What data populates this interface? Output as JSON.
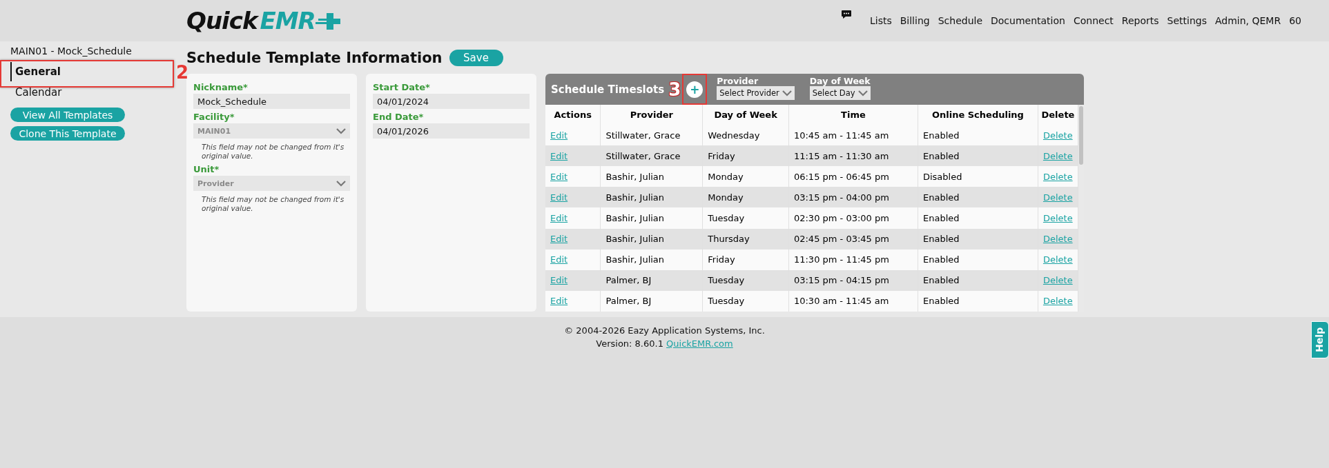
{
  "header": {
    "logo": {
      "part_1": "Quick",
      "part_2": "EMR"
    },
    "nav": [
      "Lists",
      "Billing",
      "Schedule",
      "Documentation",
      "Connect",
      "Reports",
      "Settings",
      "Admin, QEMR",
      "60"
    ]
  },
  "sidebar": {
    "title": "MAIN01 - Mock_Schedule",
    "items": [
      {
        "label": "General",
        "selected": true
      },
      {
        "label": "Calendar",
        "selected": false
      }
    ],
    "buttons": [
      "View All Templates",
      "Clone This Template"
    ]
  },
  "page": {
    "title": "Schedule Template Information",
    "save_button": "Save"
  },
  "form": {
    "fields": [
      {
        "label": "Nickname*",
        "value": "Mock_Schedule",
        "disabled": false
      },
      {
        "label": "Facility*",
        "value": "MAIN01",
        "disabled": true,
        "note": "This field may not be changed from it's original value."
      },
      {
        "label": "Unit*",
        "value": "Provider",
        "disabled": true,
        "note": "This field may not be changed from it's original value."
      }
    ],
    "dates": [
      {
        "label": "Start Date*",
        "value": "04/01/2024"
      },
      {
        "label": "End Date*",
        "value": "04/01/2026"
      }
    ]
  },
  "timeslots": {
    "title": "Schedule Timeslots",
    "add_button": "+",
    "filters": [
      {
        "label": "Provider",
        "value": "Select Provider"
      },
      {
        "label": "Day of Week",
        "value": "Select Day"
      }
    ],
    "columns": [
      "Actions",
      "Provider",
      "Day of Week",
      "Time",
      "Online Scheduling",
      "Delete"
    ],
    "rows": [
      {
        "action": "Edit",
        "provider": "Stillwater, Grace",
        "day": "Wednesday",
        "time": "10:45 am - 11:45 am",
        "online": "Enabled",
        "delete": "Delete"
      },
      {
        "action": "Edit",
        "provider": "Stillwater, Grace",
        "day": "Friday",
        "time": "11:15 am - 11:30 am",
        "online": "Enabled",
        "delete": "Delete"
      },
      {
        "action": "Edit",
        "provider": "Bashir, Julian",
        "day": "Monday",
        "time": "06:15 pm - 06:45 pm",
        "online": "Disabled",
        "delete": "Delete"
      },
      {
        "action": "Edit",
        "provider": "Bashir, Julian",
        "day": "Monday",
        "time": "03:15 pm - 04:00 pm",
        "online": "Enabled",
        "delete": "Delete"
      },
      {
        "action": "Edit",
        "provider": "Bashir, Julian",
        "day": "Tuesday",
        "time": "02:30 pm - 03:00 pm",
        "online": "Enabled",
        "delete": "Delete"
      },
      {
        "action": "Edit",
        "provider": "Bashir, Julian",
        "day": "Thursday",
        "time": "02:45 pm - 03:45 pm",
        "online": "Enabled",
        "delete": "Delete"
      },
      {
        "action": "Edit",
        "provider": "Bashir, Julian",
        "day": "Friday",
        "time": "11:30 pm - 11:45 pm",
        "online": "Enabled",
        "delete": "Delete"
      },
      {
        "action": "Edit",
        "provider": "Palmer, BJ",
        "day": "Tuesday",
        "time": "03:15 pm - 04:15 pm",
        "online": "Enabled",
        "delete": "Delete"
      },
      {
        "action": "Edit",
        "provider": "Palmer, BJ",
        "day": "Tuesday",
        "time": "10:30 am - 11:45 am",
        "online": "Enabled",
        "delete": "Delete"
      }
    ]
  },
  "footer": {
    "copyright": "© 2004-2026 Eazy Application Systems, Inc.",
    "version": "Version: 8.60.1",
    "link": "QuickEMR.com",
    "help": "Help"
  },
  "annotations": [
    {
      "label": "2"
    },
    {
      "label": "3"
    }
  ]
}
